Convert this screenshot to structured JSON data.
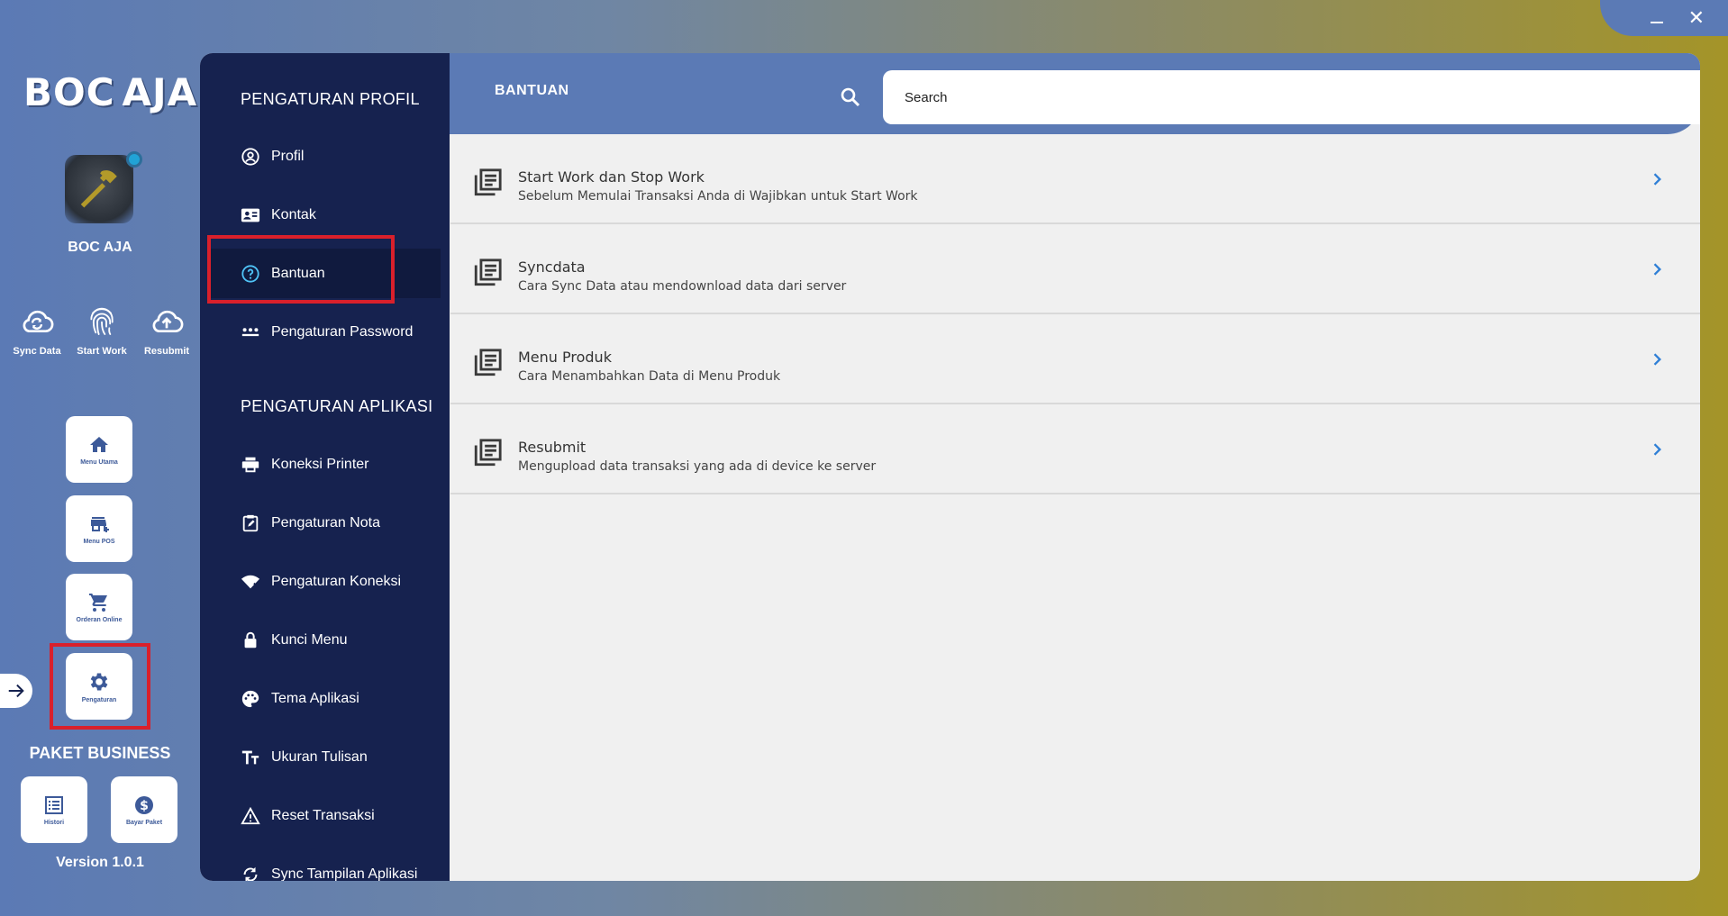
{
  "colors": {
    "accent": "#5b7ab5",
    "nav_bg": "#16224f",
    "highlight": "#d9202b",
    "icon_blue": "#3d5a99"
  },
  "window": {
    "minimize_icon": "minimize-icon",
    "close_glyph": "✕"
  },
  "brand": {
    "logo_text_left": "BOC",
    "logo_text_right": "AJA"
  },
  "user": {
    "name": "BOC AJA"
  },
  "quick_actions": [
    {
      "label": "Sync Data",
      "icon": "cloud-sync-icon"
    },
    {
      "label": "Start Work",
      "icon": "fingerprint-icon"
    },
    {
      "label": "Resubmit",
      "icon": "cloud-upload-icon"
    }
  ],
  "nav_tiles": [
    {
      "label": "Menu Utama",
      "icon": "home-icon"
    },
    {
      "label": "Menu POS",
      "icon": "store-icon"
    },
    {
      "label": "Orderan Online",
      "icon": "cart-icon"
    },
    {
      "label": "Pengaturan",
      "icon": "gear-icon"
    }
  ],
  "package": {
    "label": "PAKET BUSINESS"
  },
  "bottom_tiles": [
    {
      "label": "Histori",
      "icon": "list-icon"
    },
    {
      "label": "Bayar Paket",
      "icon": "dollar-icon"
    }
  ],
  "version": "Version 1.0.1",
  "settings_nav": {
    "profile_section": "PENGATURAN PROFIL",
    "profile_items": [
      {
        "label": "Profil",
        "icon": "account-circle-icon"
      },
      {
        "label": "Kontak",
        "icon": "contact-card-icon"
      },
      {
        "label": "Bantuan",
        "icon": "help-circle-icon",
        "active": true
      },
      {
        "label": "Pengaturan Password",
        "icon": "password-dots-icon"
      }
    ],
    "app_section": "PENGATURAN APLIKASI",
    "app_items": [
      {
        "label": "Koneksi Printer",
        "icon": "printer-icon"
      },
      {
        "label": "Pengaturan Nota",
        "icon": "note-edit-icon"
      },
      {
        "label": "Pengaturan Koneksi",
        "icon": "wifi-icon"
      },
      {
        "label": "Kunci Menu",
        "icon": "lock-icon"
      },
      {
        "label": "Tema Aplikasi",
        "icon": "palette-icon"
      },
      {
        "label": "Ukuran Tulisan",
        "icon": "text-size-icon"
      },
      {
        "label": "Reset Transaksi",
        "icon": "warning-icon"
      },
      {
        "label": "Sync Tampilan Aplikasi",
        "icon": "sync-icon"
      }
    ]
  },
  "header": {
    "title": "BANTUAN",
    "search_placeholder": "Search"
  },
  "help_items": [
    {
      "title": "Start Work dan Stop Work",
      "desc": "Sebelum Memulai Transaksi Anda di Wajibkan untuk Start Work"
    },
    {
      "title": "Syncdata",
      "desc": "Cara Sync Data atau mendownload data dari server"
    },
    {
      "title": "Menu Produk",
      "desc": "Cara Menambahkan Data di Menu Produk"
    },
    {
      "title": "Resubmit",
      "desc": "Mengupload data transaksi yang ada di device ke server"
    }
  ]
}
